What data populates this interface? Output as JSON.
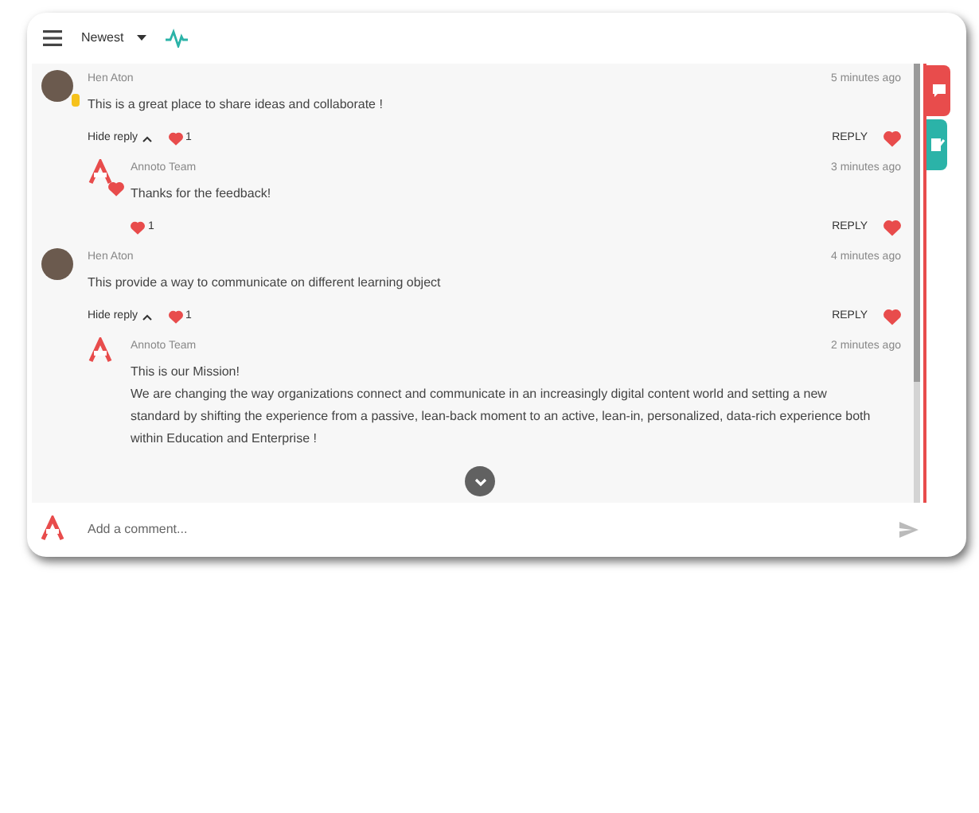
{
  "toolbar": {
    "sort": "Newest"
  },
  "comments": [
    {
      "author": "Hen Aton",
      "avatar": {
        "kind": "photo"
      },
      "badge": {
        "kind": "hand"
      },
      "time": "5 minutes ago",
      "text": "This is a great place to share ideas and collaborate !",
      "hide_reply": "Hide reply",
      "likes": "1",
      "liked": true,
      "reply": "REPLY",
      "replies": [
        {
          "author": "Annoto Team",
          "avatar": {
            "kind": "logo"
          },
          "badge": {
            "kind": "heart"
          },
          "time": "3 minutes ago",
          "text": "Thanks for the feedback!",
          "likes": "1",
          "liked": true,
          "reply": "REPLY"
        }
      ]
    },
    {
      "author": "Hen Aton",
      "avatar": {
        "kind": "photo"
      },
      "time": "4 minutes ago",
      "text": "This provide a way to communicate on different learning object",
      "hide_reply": "Hide reply",
      "likes": "1",
      "liked": true,
      "reply": "REPLY",
      "replies": [
        {
          "author": "Annoto Team",
          "avatar": {
            "kind": "logo"
          },
          "time": "2 minutes ago",
          "text": "This is our Mission!\nWe are changing the way organizations connect and communicate in an increasingly digital content world and setting a new standard by shifting the experience from a passive, lean-back moment to an active, lean-in, personalized, data-rich experience both within Education and Enterprise !"
        }
      ]
    }
  ],
  "composer": {
    "placeholder": "Add a comment..."
  },
  "side_tabs": [
    {
      "kind": "comments",
      "color": "#e84c4c",
      "selected": true
    },
    {
      "kind": "notes",
      "color": "#2bb3a8",
      "selected": false
    }
  ]
}
